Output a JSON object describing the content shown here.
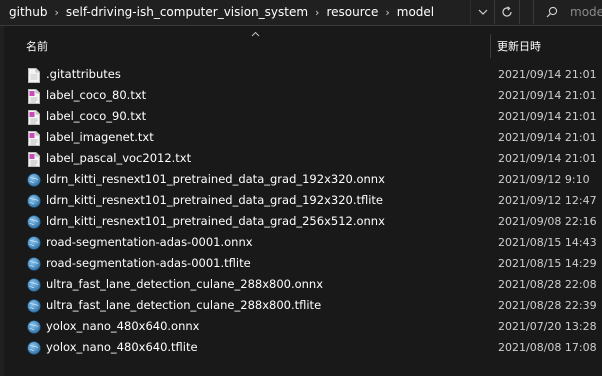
{
  "breadcrumb": [
    "github",
    "self-driving-ish_computer_vision_system",
    "resource",
    "model"
  ],
  "search": {
    "placeholder": "mode"
  },
  "columns": {
    "name": "名前",
    "date": "更新日時"
  },
  "files": [
    {
      "name": ".gitattributes",
      "date": "2021/09/14 21:01",
      "icon": "generic-file-icon"
    },
    {
      "name": "label_coco_80.txt",
      "date": "2021/09/14 21:01",
      "icon": "text-file-icon"
    },
    {
      "name": "label_coco_90.txt",
      "date": "2021/09/14 21:01",
      "icon": "text-file-icon"
    },
    {
      "name": "label_imagenet.txt",
      "date": "2021/09/14 21:01",
      "icon": "text-file-icon"
    },
    {
      "name": "label_pascal_voc2012.txt",
      "date": "2021/09/14 21:01",
      "icon": "text-file-icon"
    },
    {
      "name": "ldrn_kitti_resnext101_pretrained_data_grad_192x320.onnx",
      "date": "2021/09/12 9:10",
      "icon": "model-file-icon"
    },
    {
      "name": "ldrn_kitti_resnext101_pretrained_data_grad_192x320.tflite",
      "date": "2021/09/12 12:47",
      "icon": "model-file-icon"
    },
    {
      "name": "ldrn_kitti_resnext101_pretrained_data_grad_256x512.onnx",
      "date": "2021/09/08 22:16",
      "icon": "model-file-icon"
    },
    {
      "name": "road-segmentation-adas-0001.onnx",
      "date": "2021/08/15 14:43",
      "icon": "model-file-icon"
    },
    {
      "name": "road-segmentation-adas-0001.tflite",
      "date": "2021/08/15 14:29",
      "icon": "model-file-icon"
    },
    {
      "name": "ultra_fast_lane_detection_culane_288x800.onnx",
      "date": "2021/08/28 22:08",
      "icon": "model-file-icon"
    },
    {
      "name": "ultra_fast_lane_detection_culane_288x800.tflite",
      "date": "2021/08/28 22:39",
      "icon": "model-file-icon"
    },
    {
      "name": "yolox_nano_480x640.onnx",
      "date": "2021/07/20 13:28",
      "icon": "model-file-icon"
    },
    {
      "name": "yolox_nano_480x640.tflite",
      "date": "2021/08/08 17:08",
      "icon": "model-file-icon"
    }
  ],
  "icons": {
    "refresh": "refresh-icon",
    "dropdown": "chevron-down-icon",
    "search": "search-icon",
    "sort": "sort-up-icon"
  },
  "colors": {
    "background": "#191919",
    "text": "#ffffff",
    "date_text": "#cfcfcf",
    "globe": "#4a93c9"
  }
}
